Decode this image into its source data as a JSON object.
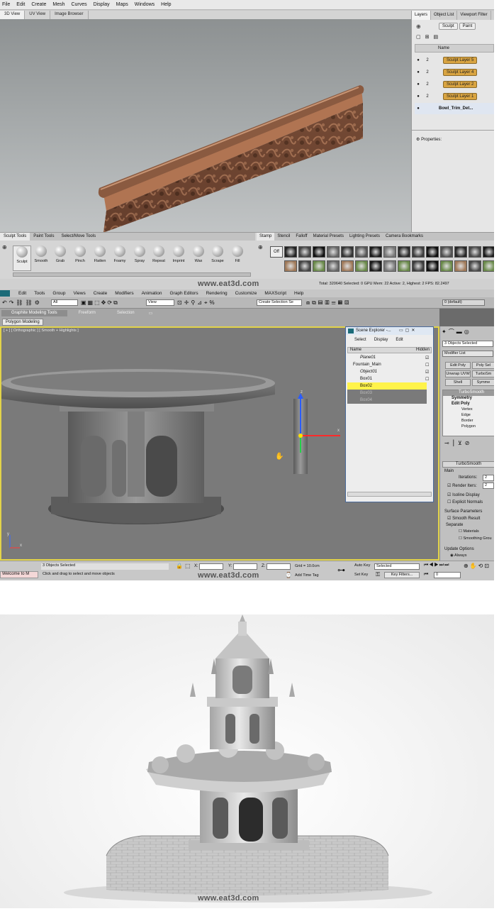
{
  "mudbox": {
    "menu": [
      "File",
      "Edit",
      "Create",
      "Mesh",
      "Curves",
      "Display",
      "Maps",
      "Windows",
      "Help"
    ],
    "view_tabs": [
      "3D View",
      "UV View",
      "Image Browser"
    ],
    "right_tabs": [
      "Layers",
      "Object List",
      "Viewport Filter"
    ],
    "layer_buttons": [
      "Sculpt",
      "Paint"
    ],
    "layer_header": "Name",
    "layers": [
      {
        "num": "2",
        "name": "Sculpt Layer 5"
      },
      {
        "num": "2",
        "name": "Sculpt Layer 4"
      },
      {
        "num": "2",
        "name": "Sculpt Layer 2"
      },
      {
        "num": "2",
        "name": "Sculpt Layer 1"
      }
    ],
    "base_mesh": "Bowl_Trim_Det...",
    "properties_label": "Properties:",
    "tool_tabs": [
      "Sculpt Tools",
      "Paint Tools",
      "Select/Move Tools"
    ],
    "tools": [
      "Sculpt",
      "Smooth",
      "Grab",
      "Pinch",
      "Flatten",
      "Foamy",
      "Spray",
      "Repeat",
      "Imprint",
      "Wax",
      "Scrape",
      "Fill"
    ],
    "stamp_tabs": [
      "Stamp",
      "Stencil",
      "Falloff",
      "Material Presets",
      "Lighting Presets",
      "Camera Bookmarks"
    ],
    "stamp_off": "Off",
    "watermark": "www.eat3d.com",
    "status": "Total: 320640  Selected: 0  GPU Mem: 22  Active: 2, Highest: 2  FPS: 82.2497"
  },
  "max": {
    "menu": [
      "Edit",
      "Tools",
      "Group",
      "Views",
      "Create",
      "Modifiers",
      "Animation",
      "Graph Editors",
      "Rendering",
      "Customize",
      "MAXScript",
      "Help"
    ],
    "toolbar": {
      "filter": "All",
      "view": "View",
      "selection_set": "Create Selection Se",
      "layer": "0 (default)"
    },
    "ribbon_tabs": [
      "Graphite Modeling Tools",
      "Freeform",
      "Selection"
    ],
    "ribbon_sub": "Polygon Modeling",
    "viewport_label": "[ + ] [ Orthographic ] [ Smooth + Highlights ]",
    "scene_explorer": {
      "title": "Scene Explorer -...",
      "menu": [
        "Select",
        "Display",
        "Edit"
      ],
      "columns": [
        "Name",
        "Hidden"
      ],
      "rows": [
        "Plane01",
        "Fountain_Main",
        "Object01",
        "Box01",
        "Box02",
        "Box03",
        "Box04"
      ]
    },
    "cmd": {
      "objects_selected": "3 Objects Selected",
      "modifier_list": "Modifier List",
      "buttons": [
        "Edit Poly",
        "Poly Sel",
        "Unwrap UVW",
        "TurboSm",
        "Shell",
        "Symme"
      ],
      "stack": [
        "TurboSmooth",
        "Symmetry",
        "Edit Poly",
        "Vertex",
        "Edge",
        "Border",
        "Polygon"
      ],
      "rollout": "TurboSmooth",
      "main": "Main",
      "iterations_label": "Iterations:",
      "iterations": "2",
      "render_iters_label": "Render Iters:",
      "render_iters": "2",
      "isoline": "Isoline Display",
      "explicit": "Explicit Normals",
      "surface_params": "Surface Parameters",
      "smooth_result": "Smooth Result",
      "separate": "Separate",
      "materials": "Materials",
      "smoothing_groups": "Smoothing Grou",
      "update_options": "Update Options",
      "always": "Always"
    },
    "status": {
      "welcome": "Welcome to M",
      "objects": "3 Objects Selected",
      "prompt": "Click and drag to select and move objects",
      "x_label": "X:",
      "y_label": "Y:",
      "z_label": "Z:",
      "grid": "Grid = 10.0cm",
      "add_time_tag": "Add Time Tag",
      "auto_key": "Auto Key",
      "selected": "Selected",
      "set_key": "Set Key",
      "key_filters": "Key Filters...",
      "frame": "0"
    },
    "axis_y": "y",
    "axis_x": "x",
    "axis_z": "z",
    "watermark": "www.eat3d.com"
  },
  "render": {
    "watermark": "www.eat3d.com"
  }
}
